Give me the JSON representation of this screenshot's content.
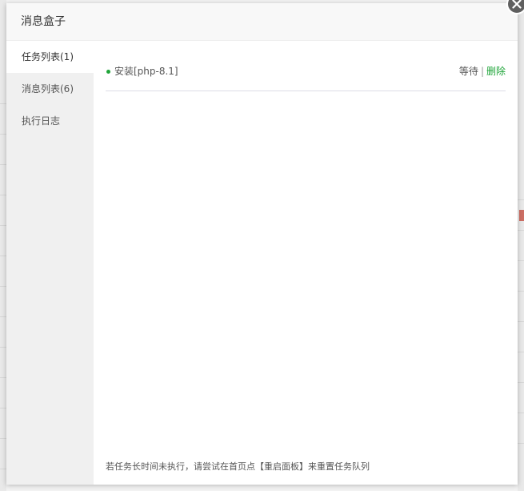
{
  "modal": {
    "title": "消息盒子"
  },
  "sidebar": {
    "items": [
      {
        "label": "任务列表(1)",
        "active": true
      },
      {
        "label": "消息列表(6)",
        "active": false
      },
      {
        "label": "执行日志",
        "active": false
      }
    ]
  },
  "tasks": [
    {
      "name": "安装[php-8.1]",
      "status": "等待",
      "separator": "|",
      "delete_label": "删除"
    }
  ],
  "footer": {
    "tip": "若任务长时间未执行，请尝试在首页点【重启面板】来重置任务队列"
  },
  "colors": {
    "accent": "#20a53a",
    "close_button": "#5f5f5f"
  },
  "icons": {
    "close": "close-icon",
    "status_dot": "status-dot-icon"
  }
}
